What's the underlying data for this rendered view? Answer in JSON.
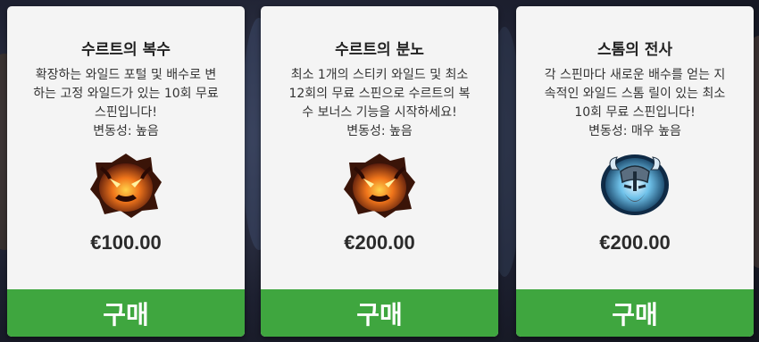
{
  "offers": [
    {
      "title": "수르트의 복수",
      "description_lines": [
        "확장하는 와일드 포털 및 배수로 변",
        "하는 고정 와일드가 있는 10회 무료",
        "스핀입니다!"
      ],
      "volatility": "변동성: 높음",
      "icon": "fire-demon-icon",
      "price": "€100.00",
      "buy_label": "구매"
    },
    {
      "title": "수르트의 분노",
      "description_lines": [
        "최소 1개의 스티키 와일드 및 최소",
        "12회의 무료 스핀으로 수르트의 복",
        "수 보너스 기능을 시작하세요!"
      ],
      "volatility": "변동성: 높음",
      "icon": "fire-demon-icon",
      "price": "€200.00",
      "buy_label": "구매"
    },
    {
      "title": "스톰의 전사",
      "description_lines": [
        "각 스핀마다 새로운 배수를 얻는 지",
        "속적인 와일드 스톰 릴이 있는 최소",
        "10회 무료 스핀입니다!"
      ],
      "volatility": "변동성: 매우 높음",
      "icon": "storm-warrior-icon",
      "price": "€200.00",
      "buy_label": "구매"
    }
  ],
  "colors": {
    "buy_button": "#3fa63f",
    "card_bg": "#f4f4f4"
  }
}
